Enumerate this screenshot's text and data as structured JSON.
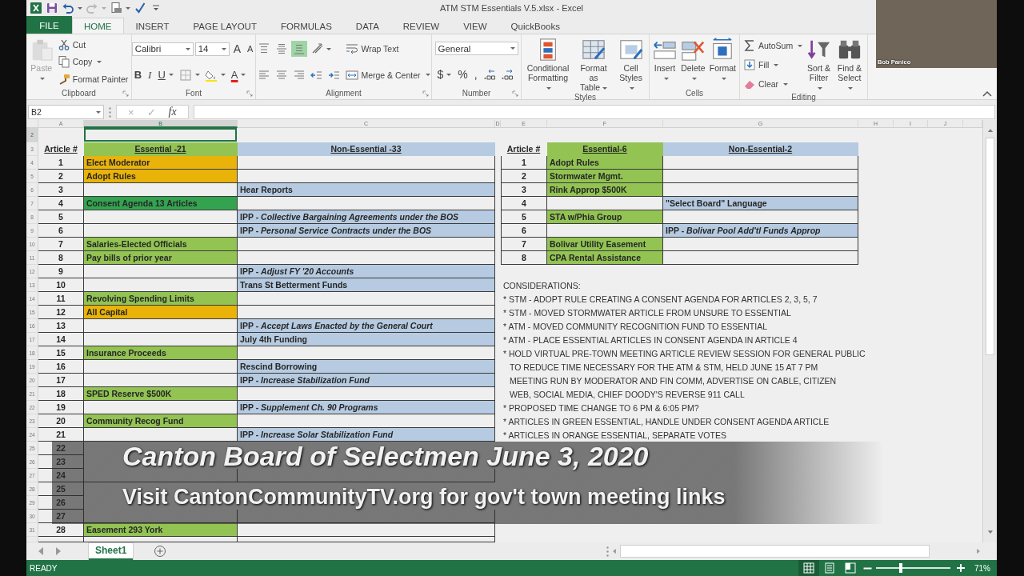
{
  "window": {
    "title": "ATM STM Essentials V.5.xlsx - Excel"
  },
  "quick_access": [
    {
      "kind": "logo",
      "disabled": false
    },
    {
      "kind": "save",
      "disabled": false
    },
    {
      "kind": "undo",
      "dropdown": true,
      "disabled": false
    },
    {
      "kind": "redo",
      "dropdown": true,
      "disabled": true
    },
    {
      "kind": "preview",
      "dropdown": true,
      "disabled": false
    },
    {
      "kind": "spelling",
      "disabled": false
    },
    {
      "kind": "more",
      "disabled": false
    }
  ],
  "tabs": [
    {
      "label": "FILE",
      "kind": "file",
      "selected": false
    },
    {
      "label": "HOME",
      "kind": "tab",
      "selected": true
    },
    {
      "label": "INSERT",
      "kind": "tab",
      "selected": false
    },
    {
      "label": "PAGE LAYOUT",
      "kind": "tab",
      "selected": false
    },
    {
      "label": "FORMULAS",
      "kind": "tab",
      "selected": false
    },
    {
      "label": "DATA",
      "kind": "tab",
      "selected": false
    },
    {
      "label": "REVIEW",
      "kind": "tab",
      "selected": false
    },
    {
      "label": "VIEW",
      "kind": "tab",
      "selected": false
    },
    {
      "label": "QuickBooks",
      "kind": "tab",
      "selected": false
    }
  ],
  "ribbon": {
    "groups": [
      {
        "label": "Clipboard",
        "launcher": true,
        "columns": [
          [
            {
              "kind": "paste",
              "label": [
                "Paste"
              ],
              "dropdown": true,
              "disabled": true
            }
          ],
          [
            {
              "kind": "cut",
              "label": [
                "Cut"
              ]
            },
            {
              "kind": "copy",
              "label": [
                "Copy"
              ],
              "dropdown": true
            },
            {
              "kind": "painter",
              "label": [
                "Format Painter"
              ]
            }
          ]
        ]
      },
      {
        "label": "Font",
        "launcher": true,
        "columns": [
          [
            {
              "kind": "row",
              "items": [
                {
                  "kind": "fontbox",
                  "value": "Calibri"
                },
                {
                  "kind": "sizebox",
                  "value": "14"
                },
                {
                  "kind": "grow",
                  "text": "A"
                },
                {
                  "kind": "shrink",
                  "text": "A"
                }
              ]
            },
            {
              "kind": "row",
              "items": [
                {
                  "kind": "bold",
                  "text": "B"
                },
                {
                  "kind": "italic",
                  "text": "I"
                },
                {
                  "kind": "underline",
                  "text": "U",
                  "dropdown": true
                },
                {
                  "kind": "borders",
                  "dropdown": true
                },
                {
                  "kind": "fillcolor",
                  "dropdown": true
                },
                {
                  "kind": "fontcolor",
                  "text": "A",
                  "dropdown": true
                }
              ]
            }
          ]
        ]
      },
      {
        "label": "Alignment",
        "launcher": true,
        "columns": [
          [
            {
              "kind": "row",
              "items": [
                {
                  "kind": "topalign",
                  "on": false
                },
                {
                  "kind": "middlealign",
                  "on": false
                },
                {
                  "kind": "bottomalign",
                  "on": true
                },
                {
                  "kind": "orientation",
                  "dropdown": true
                }
              ]
            },
            {
              "kind": "row",
              "items": [
                {
                  "kind": "leftalign"
                },
                {
                  "kind": "centeralign"
                },
                {
                  "kind": "rightalign"
                },
                {
                  "kind": "outdent"
                },
                {
                  "kind": "indent"
                }
              ]
            }
          ],
          [
            {
              "kind": "wrap",
              "label": [
                "Wrap Text"
              ]
            },
            {
              "kind": "merge",
              "label": [
                "Merge & Center"
              ],
              "dropdown": true
            }
          ]
        ]
      },
      {
        "label": "Number",
        "launcher": true,
        "columns": [
          [
            {
              "kind": "row",
              "items": [
                {
                  "kind": "formatbox",
                  "value": "General"
                }
              ]
            },
            {
              "kind": "row",
              "items": [
                {
                  "kind": "currency",
                  "text": "$",
                  "dropdown": true
                },
                {
                  "kind": "percent",
                  "text": "%"
                },
                {
                  "kind": "comma",
                  "text": ","
                },
                {
                  "kind": "adddecimal"
                },
                {
                  "kind": "cutdecimal"
                }
              ]
            }
          ]
        ]
      },
      {
        "label": "Styles",
        "columns": [
          [
            {
              "kind": "conditional",
              "label": [
                "Conditional",
                "Formatting"
              ],
              "dropdown": true
            }
          ],
          [
            {
              "kind": "tablestyle",
              "label": [
                "Format as",
                "Table"
              ],
              "dropdown": true
            }
          ],
          [
            {
              "kind": "cellstyle",
              "label": [
                "Cell",
                "Styles"
              ],
              "dropdown": true
            }
          ]
        ]
      },
      {
        "label": "Cells",
        "columns": [
          [
            {
              "kind": "insert",
              "label": [
                "Insert"
              ],
              "dropdown": true
            }
          ],
          [
            {
              "kind": "delete",
              "label": [
                "Delete"
              ],
              "dropdown": true
            }
          ],
          [
            {
              "kind": "format",
              "label": [
                "Format"
              ],
              "dropdown": true
            }
          ]
        ]
      },
      {
        "label": "Editing",
        "columns": [
          [
            {
              "kind": "autosum",
              "label": [
                "AutoSum"
              ],
              "dropdown": true
            },
            {
              "kind": "filldown",
              "label": [
                "Fill"
              ],
              "dropdown": true
            },
            {
              "kind": "clear",
              "label": [
                "Clear"
              ],
              "dropdown": true
            }
          ],
          [
            {
              "kind": "sort",
              "label": [
                "Sort &",
                "Filter"
              ],
              "dropdown": true
            }
          ],
          [
            {
              "kind": "find",
              "label": [
                "Find &",
                "Select"
              ],
              "dropdown": true
            }
          ]
        ]
      }
    ]
  },
  "video_thumbnail": {
    "participant": "Bob Panico"
  },
  "formula_bar": {
    "name_box": "B2",
    "buttons": [
      {
        "kind": "cancel",
        "text": "×",
        "disabled": true
      },
      {
        "kind": "enter",
        "text": "✓",
        "disabled": true
      },
      {
        "kind": "function",
        "text": "fx",
        "disabled": false
      }
    ]
  },
  "column_headers": [
    {
      "label": "A",
      "selected": false
    },
    {
      "label": "B",
      "selected": true
    },
    {
      "label": "C",
      "selected": false
    },
    {
      "label": "D",
      "selected": false
    },
    {
      "label": "E",
      "selected": false
    },
    {
      "label": "F",
      "selected": false
    },
    {
      "label": "G",
      "selected": false
    },
    {
      "label": "H",
      "selected": false
    },
    {
      "label": "I",
      "selected": false
    },
    {
      "label": "J",
      "selected": false
    }
  ],
  "row_headers": [
    {
      "label": "2",
      "selected": true
    },
    {
      "label": "3",
      "selected": false
    },
    {
      "label": "4",
      "selected": false
    },
    {
      "label": "5",
      "selected": false
    },
    {
      "label": "6",
      "selected": false
    },
    {
      "label": "7",
      "selected": false
    },
    {
      "label": "8",
      "selected": false
    },
    {
      "label": "9",
      "selected": false
    },
    {
      "label": "10",
      "selected": false
    },
    {
      "label": "11",
      "selected": false
    },
    {
      "label": "12",
      "selected": false
    },
    {
      "label": "13",
      "selected": false
    },
    {
      "label": "14",
      "selected": false
    },
    {
      "label": "15",
      "selected": false
    },
    {
      "label": "16",
      "selected": false
    },
    {
      "label": "17",
      "selected": false
    },
    {
      "label": "18",
      "selected": false
    },
    {
      "label": "19",
      "selected": false
    },
    {
      "label": "20",
      "selected": false
    },
    {
      "label": "21",
      "selected": false
    },
    {
      "label": "22",
      "selected": false
    },
    {
      "label": "23",
      "selected": false
    },
    {
      "label": "24",
      "selected": false
    },
    {
      "label": "25",
      "selected": false
    },
    {
      "label": "26",
      "selected": false
    },
    {
      "label": "27",
      "selected": false
    },
    {
      "label": "28",
      "selected": false
    },
    {
      "label": "29",
      "selected": false
    },
    {
      "label": "30",
      "selected": false
    },
    {
      "label": "31",
      "selected": false
    }
  ],
  "left_table": {
    "headers": [
      {
        "text": "Article #"
      },
      {
        "text": "Essential -21",
        "color": "#92c353"
      },
      {
        "text": "Non-Essential -33",
        "color": "#b6cbe1"
      }
    ],
    "rows": [
      {
        "article": "1",
        "essential": {
          "text": "Elect Moderator",
          "color": "#e9b30a"
        }
      },
      {
        "article": "2",
        "essential": {
          "text": "Adopt Rules",
          "color": "#e9b30a"
        }
      },
      {
        "article": "3",
        "non_essential": {
          "text": "Hear Reports",
          "color": "#b6cbe1"
        }
      },
      {
        "article": "4",
        "essential": {
          "text": "Consent Agenda 13 Articles",
          "color": "#33a350"
        }
      },
      {
        "article": "5",
        "non_essential": {
          "text": "IPP - *Collective Bargaining Agreements under the BOS*",
          "color": "#b6cbe1"
        }
      },
      {
        "article": "6",
        "non_essential": {
          "text": "IPP - *Personal Service Contracts under the BOS*",
          "color": "#b6cbe1"
        }
      },
      {
        "article": "7",
        "essential": {
          "text": "Salaries-Elected Officials",
          "color": "#92c353"
        }
      },
      {
        "article": "8",
        "essential": {
          "text": "Pay bills of prior year",
          "color": "#92c353"
        }
      },
      {
        "article": "9",
        "non_essential": {
          "text": "IPP - *Adjust FY '20 Accounts*",
          "color": "#b6cbe1"
        }
      },
      {
        "article": "10",
        "non_essential": {
          "text": "Trans St Betterment Funds",
          "color": "#b6cbe1"
        }
      },
      {
        "article": "11",
        "essential": {
          "text": "Revolving Spending Limits",
          "color": "#92c353"
        }
      },
      {
        "article": "12",
        "essential": {
          "text": "All Capital",
          "color": "#e9b30a"
        }
      },
      {
        "article": "13",
        "non_essential": {
          "text": "IPP - *Accept Laws Enacted by the General Court*",
          "color": "#b6cbe1"
        }
      },
      {
        "article": "14",
        "non_essential": {
          "text": "July 4th Funding",
          "color": "#b6cbe1"
        }
      },
      {
        "article": "15",
        "essential": {
          "text": "Insurance Proceeds",
          "color": "#92c353"
        }
      },
      {
        "article": "16",
        "non_essential": {
          "text": "Rescind Borrowing",
          "color": "#b6cbe1"
        }
      },
      {
        "article": "17",
        "non_essential": {
          "text": "IPP - *Increase Stabilization Fund*",
          "color": "#b6cbe1"
        }
      },
      {
        "article": "18",
        "essential": {
          "text": "SPED Reserve $500K",
          "color": "#92c353"
        }
      },
      {
        "article": "19",
        "non_essential": {
          "text": "IPP - *Supplement Ch. 90 Programs*",
          "color": "#b6cbe1"
        }
      },
      {
        "article": "20",
        "essential": {
          "text": "Community Recog Fund",
          "color": "#92c353"
        }
      },
      {
        "article": "21",
        "non_essential": {
          "text": "IPP - *Increase Solar Stabilization Fund*",
          "color": "#b6cbe1"
        }
      },
      {
        "article": "22"
      },
      {
        "article": "23"
      },
      {
        "article": "24"
      },
      {
        "article": "25"
      },
      {
        "article": "26"
      },
      {
        "article": "27"
      },
      {
        "article": "28",
        "essential": {
          "text": "Easement 293 York",
          "color": "#92c353"
        }
      }
    ]
  },
  "right_table": {
    "headers": [
      {
        "text": "Article #"
      },
      {
        "text": "Essential-6",
        "color": "#92c353"
      },
      {
        "text": "Non-Essential-2",
        "color": "#b6cbe1"
      }
    ],
    "rows": [
      {
        "article": "1",
        "essential": {
          "text": "Adopt Rules",
          "color": "#92c353"
        }
      },
      {
        "article": "2",
        "essential": {
          "text": "Stormwater Mgmt.",
          "color": "#92c353"
        }
      },
      {
        "article": "3",
        "essential": {
          "text": "Rink Approp $500K",
          "color": "#92c353"
        }
      },
      {
        "article": "4",
        "non_essential": {
          "text": "\"Select Board\" Language",
          "color": "#b6cbe1"
        }
      },
      {
        "article": "5",
        "essential": {
          "text": "STA w/Phia Group",
          "color": "#92c353"
        }
      },
      {
        "article": "6",
        "non_essential": {
          "text": "IPP - *Bolivar Pool Add'tl Funds Approp*",
          "color": "#b6cbe1"
        }
      },
      {
        "article": "7",
        "essential": {
          "text": "Bolivar Utility Easement",
          "color": "#92c353"
        }
      },
      {
        "article": "8",
        "essential": {
          "text": "CPA Rental Assistance",
          "color": "#92c353"
        }
      }
    ]
  },
  "considerations": [
    {
      "kind": "heading",
      "text": "CONSIDERATIONS:"
    },
    {
      "kind": "bullet",
      "text": "* STM - ADOPT RULE CREATING A CONSENT AGENDA FOR ARTICLES 2, 3, 5, 7"
    },
    {
      "kind": "bullet",
      "text": "* STM - MOVED STORMWATER ARTICLE FROM UNSURE TO ESSENTIAL"
    },
    {
      "kind": "bullet",
      "text": "* ATM - MOVED COMMUNITY RECOGNITION FUND TO ESSENTIAL"
    },
    {
      "kind": "bullet",
      "text": "* ATM - PLACE ESSENTIAL ARTICLES IN CONSENT AGENDA IN ARTICLE 4"
    },
    {
      "kind": "bullet",
      "text": "* HOLD VIRTUAL PRE-TOWN MEETING ARTICLE REVIEW SESSION FOR GENERAL PUBLIC"
    },
    {
      "kind": "continuation",
      "text": "TO REDUCE TIME NECESSARY FOR THE ATM & STM, HELD JUNE 15 AT 7 PM"
    },
    {
      "kind": "continuation",
      "text": "MEETING RUN BY MODERATOR AND FIN COMM, ADVERTISE ON CABLE, CITIZEN"
    },
    {
      "kind": "continuation",
      "text": "WEB, SOCIAL MEDIA, CHIEF DOODY'S REVERSE 911 CALL"
    },
    {
      "kind": "bullet",
      "text": "* PROPOSED TIME CHANGE TO 6 PM & 6:05 PM?"
    },
    {
      "kind": "bullet",
      "text": "* ARTICLES IN GREEN ESSENTIAL, HANDLE UNDER CONSENT AGENDA ARTICLE"
    },
    {
      "kind": "bullet",
      "text": "* ARTICLES IN ORANGE ESSENTIAL, SEPARATE VOTES"
    }
  ],
  "video_caption": {
    "title": "Canton Board of Selectmen June 3, 2020",
    "subtitle": "Visit CantonCommunityTV.org for gov't town meeting links"
  },
  "sheet_tabs": [
    {
      "label": "Sheet1",
      "selected": true
    }
  ],
  "status_bar": {
    "mode": "READY",
    "views": [
      {
        "kind": "normal",
        "selected": true
      },
      {
        "kind": "layout",
        "selected": false
      },
      {
        "kind": "pagebreak",
        "selected": false
      }
    ],
    "zoom": {
      "level": 0.33,
      "label": "71%"
    }
  }
}
